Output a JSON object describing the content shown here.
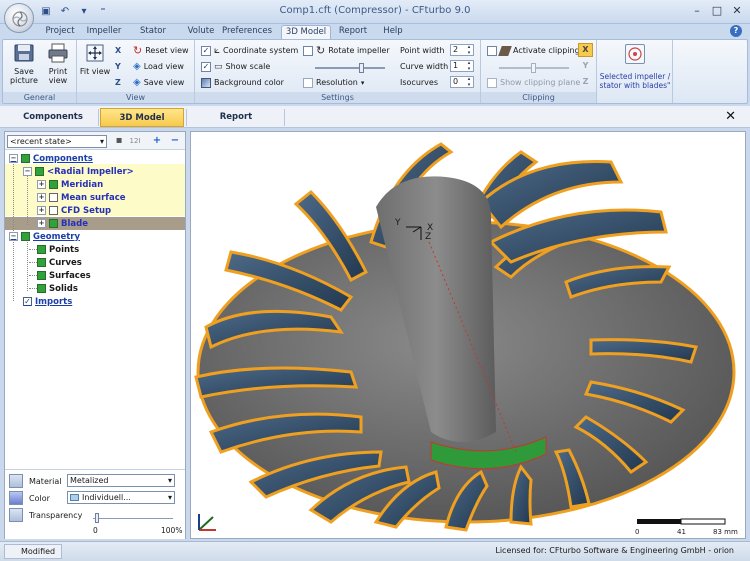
{
  "window": {
    "title": "Comp1.cft (Compressor) - CFturbo 9.0"
  },
  "ribbon_tabs": [
    {
      "label": "Project"
    },
    {
      "label": "Impeller"
    },
    {
      "label": "Stator"
    },
    {
      "label": "Volute"
    },
    {
      "label": "Preferences"
    },
    {
      "label": "3D Model",
      "active": true
    },
    {
      "label": "Report"
    },
    {
      "label": "Help"
    }
  ],
  "ribbon": {
    "general": {
      "label": "General",
      "save_picture": "Save picture",
      "print_view": "Print view"
    },
    "view": {
      "label": "View",
      "fit_view": "Fit view",
      "reset_view": "Reset view",
      "load_view": "Load view",
      "save_view": "Save view"
    },
    "settings": {
      "label": "Settings",
      "coordinate_system": "Coordinate system",
      "show_scale": "Show scale",
      "background_color": "Background color",
      "rotate_impeller": "Rotate impeller",
      "resolution": "Resolution",
      "point_width_label": "Point width",
      "point_width": "2",
      "curve_width_label": "Curve width",
      "curve_width": "1",
      "isocurves_label": "Isocurves",
      "isocurves": "0"
    },
    "clipping": {
      "label": "Clipping",
      "activate_clipping": "Activate clipping",
      "show_clipping_plane": "Show clipping plane"
    },
    "selected": {
      "label": "Selected impeller / stator with blades\""
    }
  },
  "subtabs": [
    {
      "label": "Components"
    },
    {
      "label": "3D Model",
      "active": true
    },
    {
      "label": "Report"
    }
  ],
  "left_panel": {
    "recent_state": "<recent state>",
    "tree": {
      "components": "Components",
      "radial_impeller": "<Radial Impeller>",
      "meridian": "Meridian",
      "mean_surface": "Mean surface",
      "cfd_setup": "CFD Setup",
      "blade": "Blade",
      "geometry": "Geometry",
      "points": "Points",
      "curves": "Curves",
      "surfaces": "Surfaces",
      "solids": "Solids",
      "imports": "Imports"
    },
    "properties": {
      "material_label": "Material",
      "material_value": "Metalized",
      "color_label": "Color",
      "color_value": "Individuell...",
      "transparency_label": "Transparency",
      "transparency_min": "0",
      "transparency_max": "100%",
      "transparency_level": 0.02
    }
  },
  "viewport": {
    "axis_y": "Y",
    "axis_x": "X",
    "axis_z": "Z",
    "scale_0": "0",
    "scale_41": "41",
    "scale_83": "83 mm"
  },
  "status": {
    "left": "Modified",
    "right": "Licensed for: CFturbo Software & Engineering GmbH - orion"
  },
  "colors": {
    "blade_outline": "#f0a020",
    "hub": "#6b6b6b",
    "blade_face": "#2f4a66",
    "band": "#2f9a3a",
    "active_tab": "#f7c94c"
  }
}
